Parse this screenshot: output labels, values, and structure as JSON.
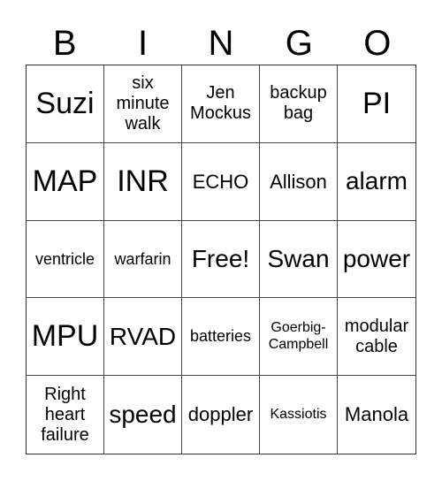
{
  "header": {
    "letters": [
      "B",
      "I",
      "N",
      "G",
      "O"
    ]
  },
  "cells": [
    {
      "text": "Suzi",
      "size": "s-xl"
    },
    {
      "text": "six minute walk",
      "size": "s-ms"
    },
    {
      "text": "Jen Mockus",
      "size": "s-ms"
    },
    {
      "text": "backup bag",
      "size": "s-ms"
    },
    {
      "text": "PI",
      "size": "s-xl"
    },
    {
      "text": "MAP",
      "size": "s-xl"
    },
    {
      "text": "INR",
      "size": "s-xl"
    },
    {
      "text": "ECHO",
      "size": "s-m"
    },
    {
      "text": "Allison",
      "size": "s-m"
    },
    {
      "text": "alarm",
      "size": "s-l"
    },
    {
      "text": "ventricle",
      "size": "s-s"
    },
    {
      "text": "warfarin",
      "size": "s-s"
    },
    {
      "text": "Free!",
      "size": "s-l"
    },
    {
      "text": "Swan",
      "size": "s-l"
    },
    {
      "text": "power",
      "size": "s-l"
    },
    {
      "text": "MPU",
      "size": "s-xl"
    },
    {
      "text": "RVAD",
      "size": "s-l"
    },
    {
      "text": "batteries",
      "size": "s-s"
    },
    {
      "text": "Goerbig-Campbell",
      "size": "s-xs"
    },
    {
      "text": "modular cable",
      "size": "s-ms"
    },
    {
      "text": "Right heart failure",
      "size": "s-ms"
    },
    {
      "text": "speed",
      "size": "s-l"
    },
    {
      "text": "doppler",
      "size": "s-m"
    },
    {
      "text": "Kassiotis",
      "size": "s-xs"
    },
    {
      "text": "Manola",
      "size": "s-m"
    }
  ]
}
